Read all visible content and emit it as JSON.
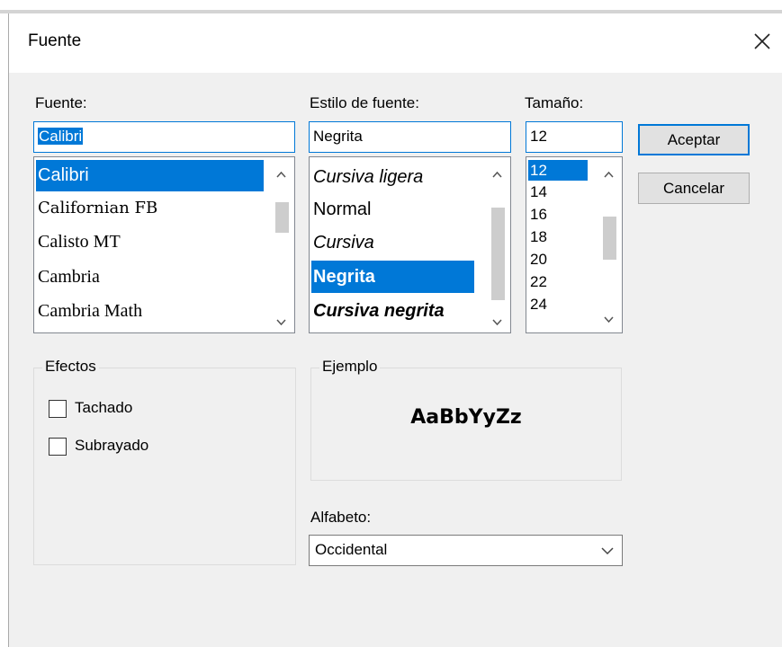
{
  "dialog": {
    "title": "Fuente"
  },
  "font": {
    "label": "Fuente:",
    "value": "Calibri",
    "items": [
      {
        "label": "Calibri",
        "selected": true
      },
      {
        "label": "Californian FB",
        "selected": false
      },
      {
        "label": "Calisto MT",
        "selected": false
      },
      {
        "label": "Cambria",
        "selected": false
      },
      {
        "label": "Cambria Math",
        "selected": false
      }
    ]
  },
  "style": {
    "label": "Estilo de fuente:",
    "value": "Negrita",
    "items": [
      {
        "label": "Cursiva ligera",
        "selected": false
      },
      {
        "label": "Normal",
        "selected": false
      },
      {
        "label": "Cursiva",
        "selected": false
      },
      {
        "label": "Negrita",
        "selected": true
      },
      {
        "label": "Cursiva negrita",
        "selected": false
      }
    ]
  },
  "size": {
    "label": "Tamaño:",
    "value": "12",
    "items": [
      {
        "label": "12",
        "selected": true
      },
      {
        "label": "14",
        "selected": false
      },
      {
        "label": "16",
        "selected": false
      },
      {
        "label": "18",
        "selected": false
      },
      {
        "label": "20",
        "selected": false
      },
      {
        "label": "22",
        "selected": false
      },
      {
        "label": "24",
        "selected": false
      }
    ]
  },
  "buttons": {
    "ok": "Aceptar",
    "cancel": "Cancelar"
  },
  "effects": {
    "label": "Efectos",
    "strikethrough": {
      "label": "Tachado",
      "checked": false
    },
    "underline": {
      "label": "Subrayado",
      "checked": false
    }
  },
  "sample": {
    "label": "Ejemplo",
    "text": "AaBbYyZz"
  },
  "script": {
    "label": "Alfabeto:",
    "value": "Occidental"
  },
  "colors": {
    "accent": "#0078d7",
    "dialog_bg": "#f0f0f0",
    "button_bg": "#e1e1e1"
  },
  "icons": {
    "close": "close-icon",
    "scroll_up": "chevron-up-icon",
    "scroll_down": "chevron-down-icon",
    "dropdown": "chevron-down-icon"
  }
}
